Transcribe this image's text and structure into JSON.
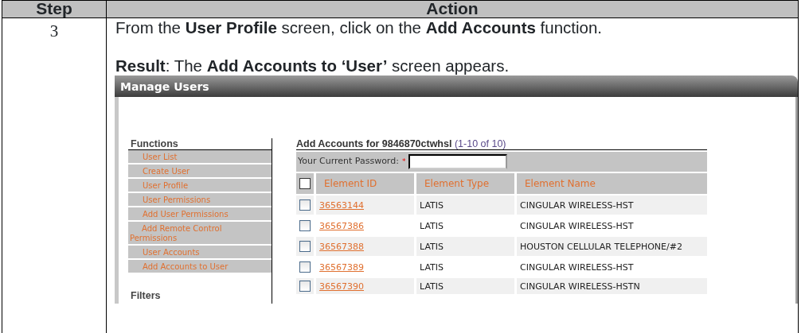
{
  "table": {
    "columns": [
      "Step",
      "Action"
    ],
    "rows": [
      {
        "step": "3",
        "instruction": "From the **User Profile** screen, click on the **Add Accounts** function.",
        "result": "**Result**:  The **Add Accounts to ‘User’** screen appears."
      }
    ]
  },
  "screenshot": {
    "window_title": "Manage Users",
    "sidebar": {
      "heading": "Functions",
      "items": [
        {
          "label": "User List"
        },
        {
          "label": "Create User"
        },
        {
          "label": "User Profile"
        },
        {
          "label": "User Permissions"
        },
        {
          "label": "Add User Permissions"
        },
        {
          "label": "Add Remote Control Permissions"
        },
        {
          "label": "User Accounts"
        },
        {
          "label": "Add Accounts to User"
        }
      ],
      "next_heading": "Filters"
    },
    "main": {
      "heading": "Add Accounts for 9846870ctwhsl",
      "count": "(1-10 of 10)",
      "password_label": "Your Current Password:",
      "required_mark": "*",
      "select_all_checked": false,
      "columns": [
        "Element ID",
        "Element Type",
        "Element Name"
      ],
      "rows": [
        {
          "checked": false,
          "id": "36563144",
          "type": "LATIS",
          "name": "CINGULAR WIRELESS-HST"
        },
        {
          "checked": false,
          "id": "36567386",
          "type": "LATIS",
          "name": "CINGULAR WIRELESS-HST"
        },
        {
          "checked": false,
          "id": "36567388",
          "type": "LATIS",
          "name": "HOUSTON CELLULAR TELEPHONE/#2"
        },
        {
          "checked": false,
          "id": "36567389",
          "type": "LATIS",
          "name": "CINGULAR WIRELESS-HST"
        },
        {
          "checked": false,
          "id": "36567390",
          "type": "LATIS",
          "name": "CINGULAR WIRELESS-HSTN"
        }
      ]
    }
  }
}
